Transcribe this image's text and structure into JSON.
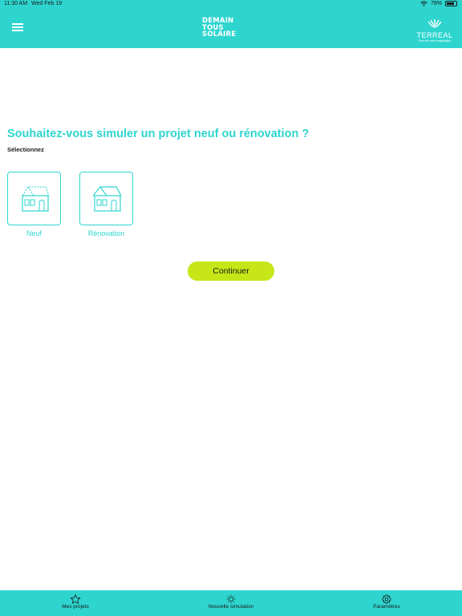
{
  "status_bar": {
    "time": "11:30 AM",
    "date": "Wed Feb 19",
    "battery": "78%",
    "battery_level": 0.78
  },
  "header": {
    "logo_lines": [
      "DEMAIN",
      "TOUS",
      "SOLAIRE"
    ],
    "brand": "TERREAL",
    "brand_tagline": "Terre de notre imagination"
  },
  "main": {
    "question": "Souhaitez-vous simuler un projet neuf ou rénovation ?",
    "instruction": "Sélectionnez",
    "options": [
      {
        "label": "Neuf",
        "icon": "new-house-icon"
      },
      {
        "label": "Rénovation",
        "icon": "renovation-house-icon"
      }
    ],
    "continue_label": "Continuer"
  },
  "tabbar": {
    "items": [
      {
        "label": "Mes projets",
        "icon": "star-icon"
      },
      {
        "label": "Nouvelle simulation",
        "icon": "sun-icon"
      },
      {
        "label": "Paramètres",
        "icon": "gear-icon"
      }
    ]
  },
  "colors": {
    "primary": "#2ed5cf",
    "accent": "#c6e617",
    "text": "#1a1a1a"
  }
}
